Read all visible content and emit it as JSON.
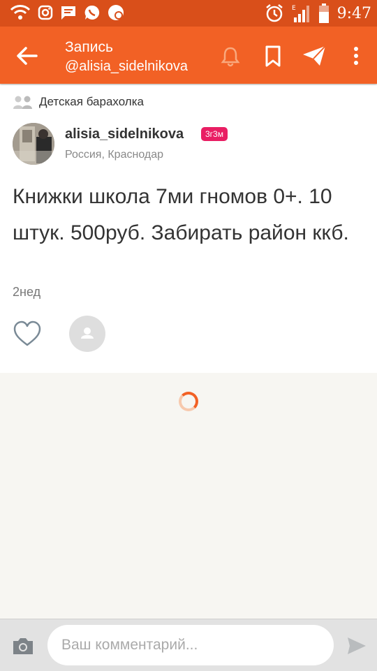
{
  "status_bar": {
    "time": "9:47",
    "icons": [
      "wifi-icon",
      "instagram-icon",
      "message-icon",
      "whatsapp-icon",
      "notification-icon",
      "alarm-icon",
      "signal-icon",
      "battery-icon"
    ]
  },
  "header": {
    "title": "Запись",
    "subtitle": "@alisia_sidelnikova",
    "icons": [
      "back-arrow-icon",
      "bell-icon",
      "bookmark-icon",
      "send-icon",
      "more-vertical-icon"
    ]
  },
  "post": {
    "group_name": "Детская барахолка",
    "author_name": "alisia_sidelnikova",
    "author_badge": "3г3м",
    "author_location": "Россия, Краснодар",
    "text": "Книжки школа 7ми гномов 0+. 10 штук. 500руб. Забирать район ккб.",
    "age": "2нед"
  },
  "comment": {
    "placeholder": "Ваш комментарий..."
  },
  "colors": {
    "accent": "#f26125",
    "status_bar": "#d94f1a",
    "badge": "#e91e63"
  }
}
